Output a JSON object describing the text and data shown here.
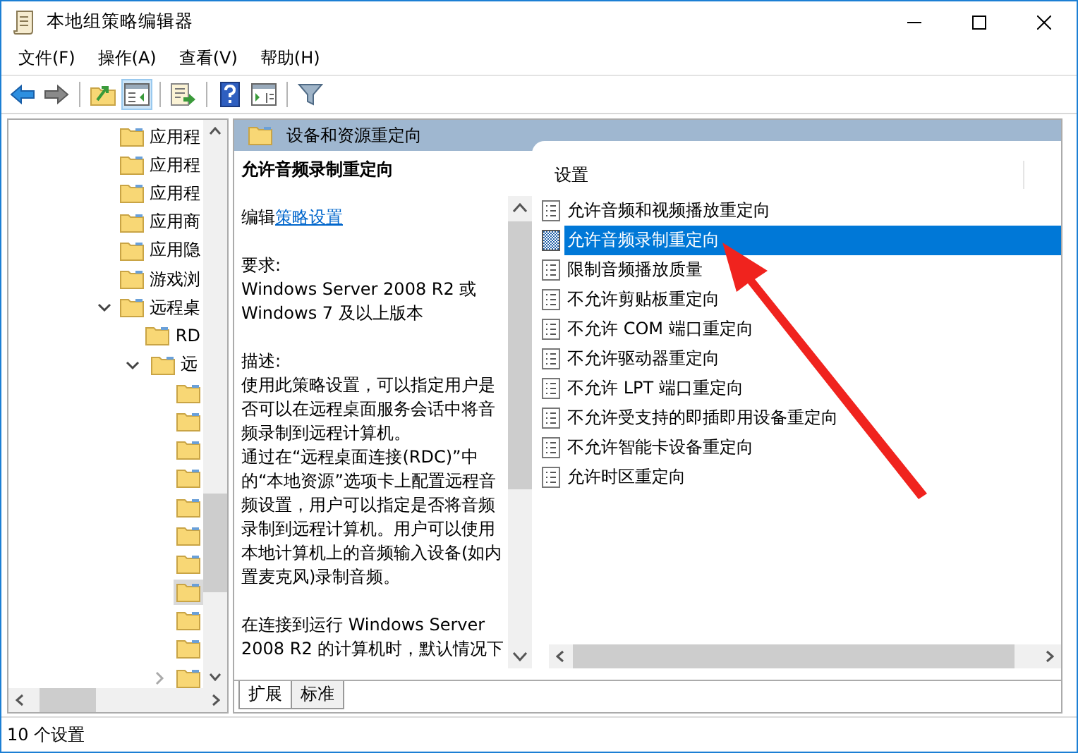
{
  "window": {
    "title": "本地组策略编辑器"
  },
  "menu": [
    "文件(F)",
    "操作(A)",
    "查看(V)",
    "帮助(H)"
  ],
  "toolbar": [
    [
      {
        "kind": "back",
        "pressed": false
      },
      {
        "kind": "forward",
        "pressed": false
      }
    ],
    [
      {
        "kind": "folder-up",
        "pressed": false
      },
      {
        "kind": "tree-toggle",
        "pressed": true
      }
    ],
    [
      {
        "kind": "export",
        "pressed": false
      }
    ],
    [
      {
        "kind": "help",
        "pressed": false
      },
      {
        "kind": "pane-view",
        "pressed": false
      }
    ],
    [
      {
        "kind": "filter",
        "pressed": false
      }
    ]
  ],
  "tree": {
    "items": [
      {
        "label": "应用程",
        "selected": false
      },
      {
        "label": "应用程",
        "selected": false
      },
      {
        "label": "应用程",
        "selected": false
      },
      {
        "label": "应用商",
        "selected": false
      },
      {
        "label": "应用隐",
        "selected": false
      },
      {
        "label": "游戏浏",
        "selected": false
      },
      {
        "label": "远程桌",
        "selected": false,
        "expanded": true,
        "children": [
          {
            "label": "RD",
            "selected": false
          },
          {
            "label": "远",
            "selected": false,
            "expanded": true,
            "children": [
              {
                "selected": false
              },
              {
                "selected": false
              },
              {
                "selected": false
              },
              {
                "selected": false
              },
              {
                "selected": false
              },
              {
                "selected": false
              },
              {
                "selected": false
              },
              {
                "selected": true
              },
              {
                "selected": false
              },
              {
                "selected": false
              },
              {
                "selected": false,
                "expanded": false
              }
            ]
          }
        ]
      }
    ]
  },
  "details": {
    "header": "设备和资源重定向",
    "title": "允许音频录制重定向",
    "edit_prefix": "编辑",
    "edit_link": "策略设置",
    "requirements_label": "要求:",
    "requirements": "Windows Server 2008 R2 或 Windows 7 及以上版本",
    "description_label": "描述:",
    "description": [
      "使用此策略设置，可以指定用户是否可以在远程桌面服务会话中将音频录制到远程计算机。",
      "通过在“远程桌面连接(RDC)”中的“本地资源”选项卡上配置远程音频设置，用户可以指定是否将音频录制到远程计算机。用户可以使用本地计算机上的音频输入设备(如内置麦克风)录制音频。"
    ],
    "note": "在连接到运行 Windows Server 2008 R2 的计算机时，默认情况下"
  },
  "settings": {
    "column": "设置",
    "rows": [
      {
        "label": "允许音频和视频播放重定向",
        "selected": false
      },
      {
        "label": "允许音频录制重定向",
        "selected": true
      },
      {
        "label": "限制音频播放质量",
        "selected": false
      },
      {
        "label": "不允许剪贴板重定向",
        "selected": false
      },
      {
        "label": "不允许 COM 端口重定向",
        "selected": false
      },
      {
        "label": "不允许驱动器重定向",
        "selected": false
      },
      {
        "label": "不允许 LPT 端口重定向",
        "selected": false
      },
      {
        "label": "不允许受支持的即插即用设备重定向",
        "selected": false
      },
      {
        "label": "不允许智能卡设备重定向",
        "selected": false
      },
      {
        "label": "允许时区重定向",
        "selected": false
      }
    ]
  },
  "tabs": [
    {
      "label": "扩展",
      "selected": true
    },
    {
      "label": "标准",
      "selected": false
    }
  ],
  "status_bar": "10 个设置"
}
